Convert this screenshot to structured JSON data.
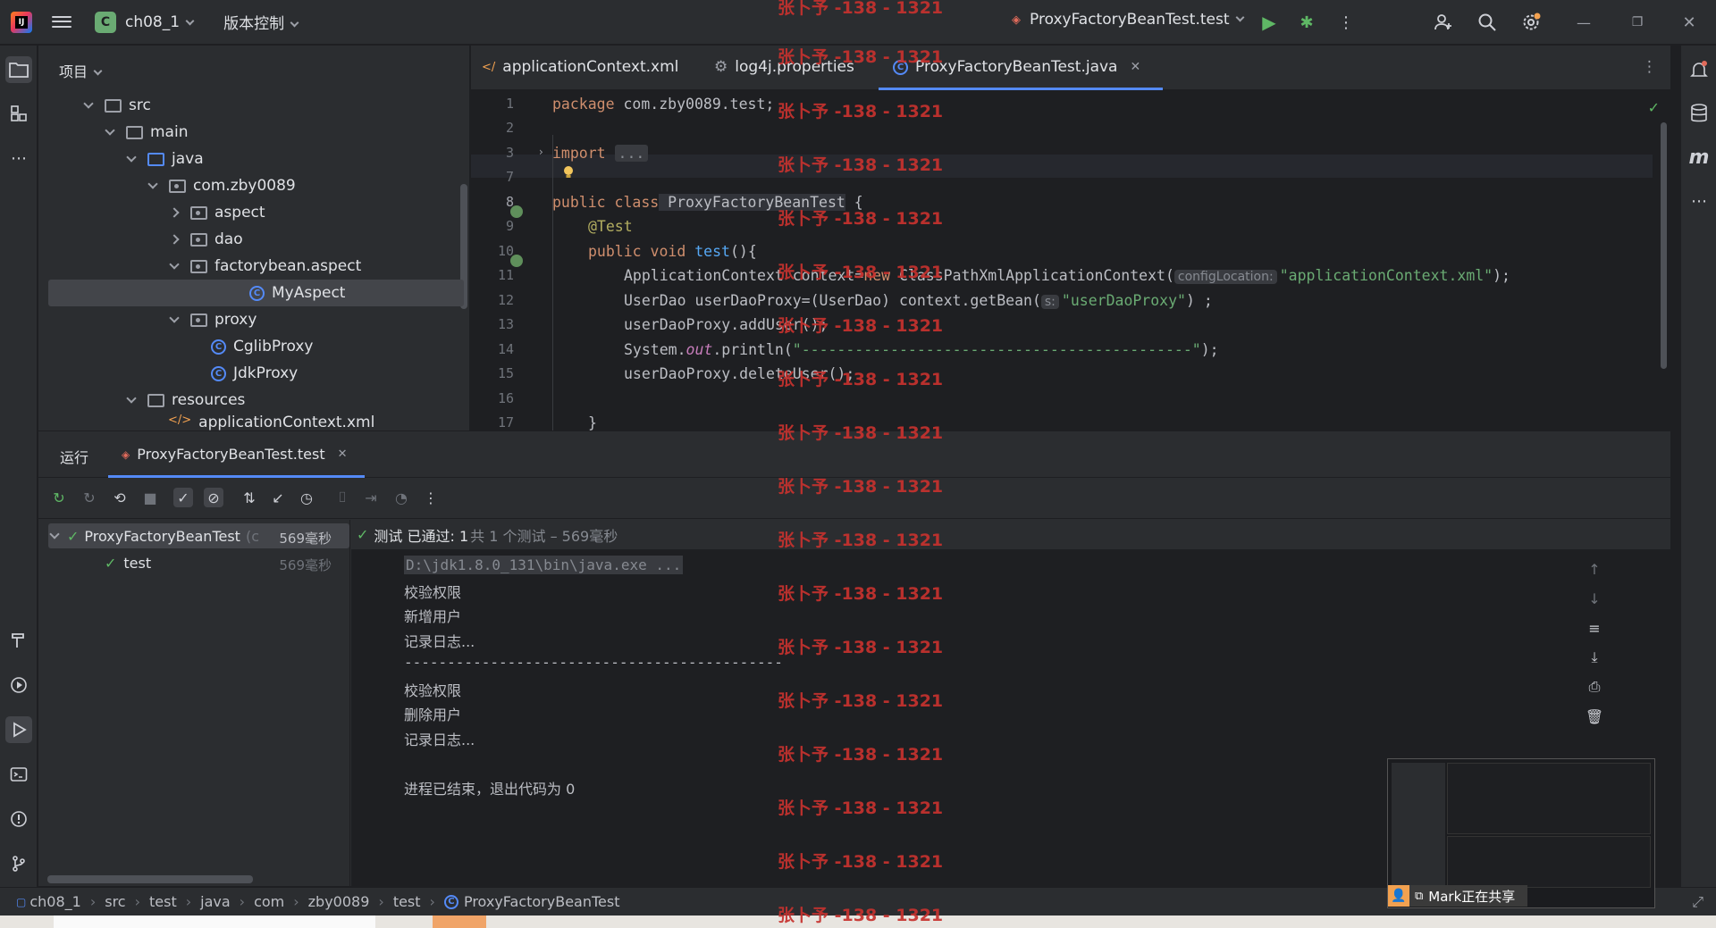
{
  "titlebar": {
    "project_badge": "C",
    "project_name": "ch08_1",
    "vcs": "版本控制",
    "run_config": "ProxyFactoryBeanTest.test"
  },
  "project_panel": {
    "title": "项目",
    "tree": [
      {
        "label": "src"
      },
      {
        "label": "main"
      },
      {
        "label": "java"
      },
      {
        "label": "com.zby0089"
      },
      {
        "label": "aspect"
      },
      {
        "label": "dao"
      },
      {
        "label": "factorybean.aspect"
      },
      {
        "label": "MyAspect"
      },
      {
        "label": "proxy"
      },
      {
        "label": "CglibProxy"
      },
      {
        "label": "JdkProxy"
      },
      {
        "label": "resources"
      },
      {
        "label": "applicationContext.xml"
      }
    ]
  },
  "editor": {
    "tabs": [
      {
        "label": "applicationContext.xml"
      },
      {
        "label": "log4j.properties"
      },
      {
        "label": "ProxyFactoryBeanTest.java"
      }
    ],
    "line_numbers": [
      "1",
      "2",
      "3",
      "7",
      "8",
      "9",
      "10",
      "11",
      "12",
      "13",
      "14",
      "15",
      "16",
      "17"
    ],
    "code": {
      "l1_kw": "package",
      "l1_rest": " com.zby0089.test;",
      "l3_kw": "import",
      "l3_fold": "...",
      "l8_kw": "public class",
      "l8_name": " ProxyFactoryBeanTest",
      "l8_brace": " {",
      "l9_ann": "@Test",
      "l10_kw": "public void",
      "l10_fn": " test",
      "l10_rest": "(){",
      "l11_a": "ApplicationContext context=",
      "l11_kw": "new",
      "l11_b": " ClassPathXmlApplicationContext(",
      "l11_hint": "configLocation:",
      "l11_str": "\"applicationContext.xml\"",
      "l11_end": ");",
      "l12_a": "UserDao userDaoProxy=(UserDao) context.getBean(",
      "l12_hint": "s:",
      "l12_str": "\"userDaoProxy\"",
      "l12_end": ") ;",
      "l13": "userDaoProxy.addUser();",
      "l14_a": "System.",
      "l14_fld": "out",
      "l14_b": ".println(",
      "l14_str": "\"--------------------------------------------\"",
      "l14_end": ");",
      "l15": "userDaoProxy.deleteUser();",
      "l17": "}"
    }
  },
  "run_panel": {
    "title": "运行",
    "tab": "ProxyFactoryBeanTest.test",
    "status_check": "测试 已通过: 1",
    "status_detail": "共 1 个测试 – 569毫秒",
    "tests": [
      {
        "name": "ProxyFactoryBeanTest",
        "suffix": "(c",
        "time": "569毫秒"
      },
      {
        "name": "test",
        "time": "569毫秒"
      }
    ],
    "console": [
      "D:\\jdk1.8.0_131\\bin\\java.exe ...",
      "校验权限",
      "新增用户",
      "记录日志...",
      "--------------------------------------------",
      "校验权限",
      "删除用户",
      "记录日志...",
      "",
      "进程已结束，退出代码为 0"
    ]
  },
  "breadcrumb": [
    "ch08_1",
    "src",
    "test",
    "java",
    "com",
    "zby0089",
    "test",
    "ProxyFactoryBeanTest"
  ],
  "share": {
    "label": "Mark正在共享"
  },
  "watermark": "张卜予 -138 - 1321",
  "colors": {
    "accent": "#548af7",
    "pass": "#5fb865",
    "watermark": "#c7322e"
  }
}
